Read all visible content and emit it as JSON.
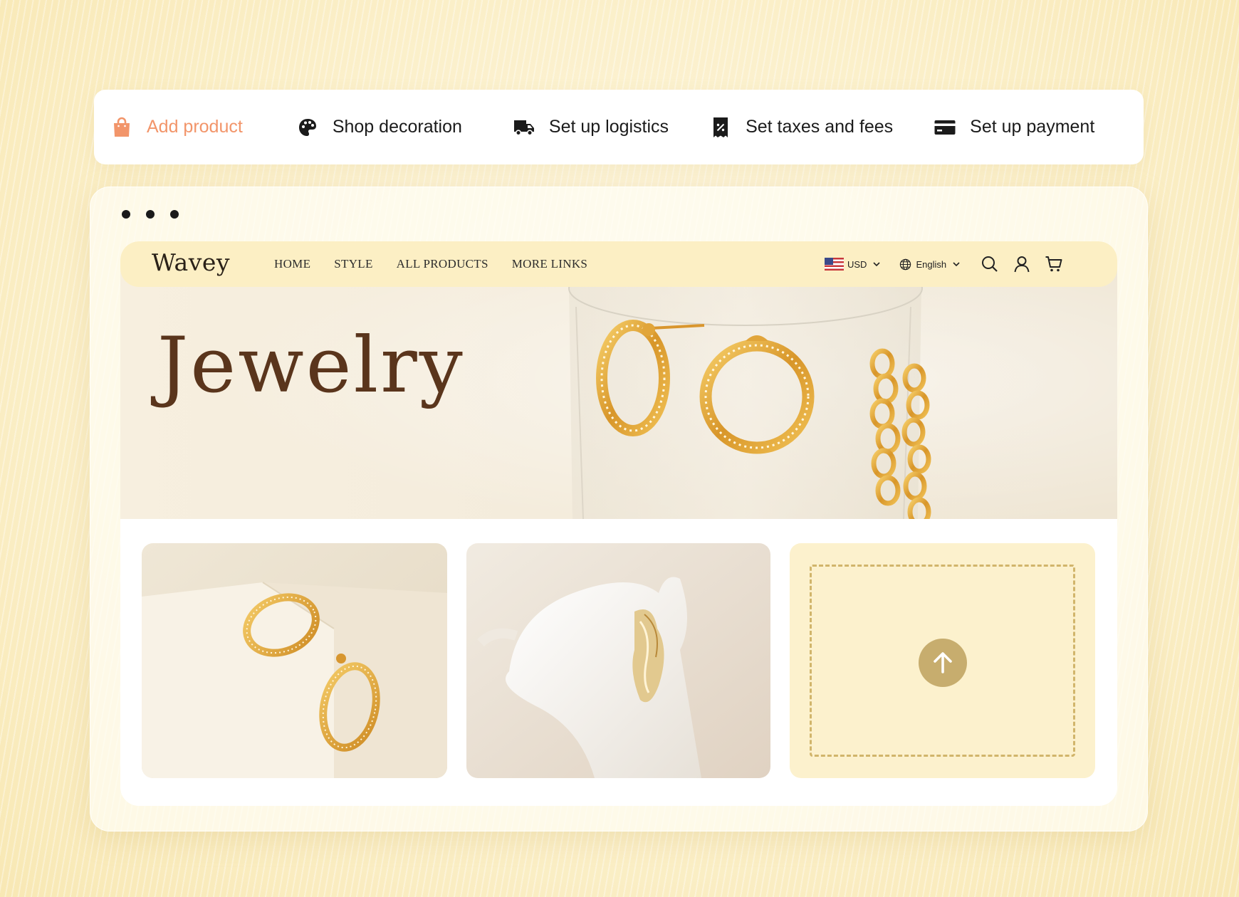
{
  "setup_steps": [
    {
      "label": "Add product",
      "icon": "shopping-bag-icon",
      "active": true
    },
    {
      "label": "Shop decoration",
      "icon": "palette-icon",
      "active": false
    },
    {
      "label": "Set up logistics",
      "icon": "truck-icon",
      "active": false
    },
    {
      "label": "Set taxes and fees",
      "icon": "receipt-percent-icon",
      "active": false
    },
    {
      "label": "Set up payment",
      "icon": "credit-card-icon",
      "active": false
    }
  ],
  "site": {
    "logo": "Wavey",
    "nav": [
      "HOME",
      "STYLE",
      "ALL PRODUCTS",
      "MORE LINKS"
    ],
    "currency": "USD",
    "language": "English",
    "hero_title": "Jewelry"
  },
  "colors": {
    "accent": "#f2956a",
    "header_bg": "#fcefc4",
    "hero_text": "#5a351c",
    "upload_button": "#c7ad6e"
  }
}
